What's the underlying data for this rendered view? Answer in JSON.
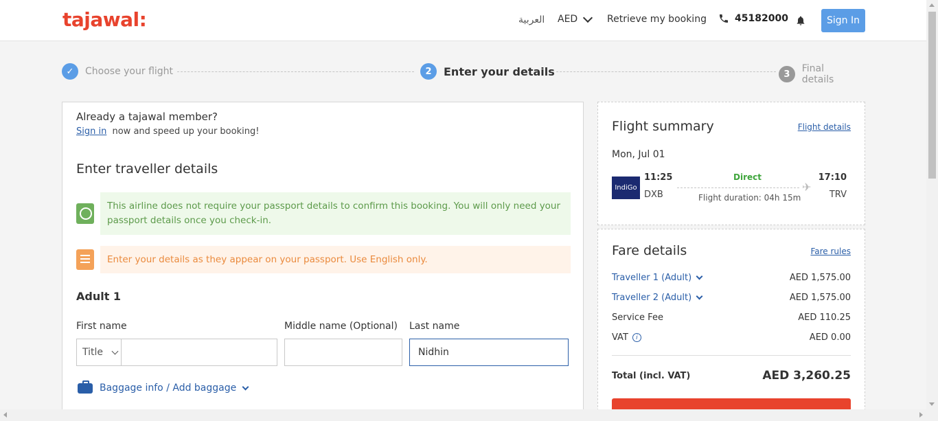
{
  "header": {
    "logo": "tajawal:",
    "language": "العربية",
    "currency": "AED",
    "retrieve": "Retrieve my booking",
    "phone": "45182000",
    "signin": "Sign In"
  },
  "stepper": {
    "step1": {
      "number": "✓",
      "label": "Choose your flight"
    },
    "step2": {
      "number": "2",
      "label": "Enter your details"
    },
    "step3": {
      "number": "3",
      "label": "Final details"
    }
  },
  "member": {
    "title": "Already a tajawal member?",
    "signin_link": "Sign in",
    "subtitle": "now and speed up your booking!"
  },
  "traveller": {
    "title": "Enter traveller details",
    "alert_passport": "This airline does not require your passport details to confirm this booking. You will only need your passport details once you check-in.",
    "alert_english": "Enter your details as they appear on your passport. Use English only.",
    "adult_title": "Adult 1",
    "first_name_label": "First name",
    "middle_name_label": "Middle name (Optional)",
    "last_name_label": "Last name",
    "title_select": "Title",
    "first_name_value": "",
    "middle_name_value": "",
    "last_name_value": "Nidhin",
    "baggage_link": "Baggage info / Add baggage"
  },
  "summary": {
    "title": "Flight summary",
    "details_link": "Flight details",
    "date": "Mon, Jul 01",
    "airline": "IndiGo",
    "dep_time": "11:25",
    "dep_code": "DXB",
    "stops": "Direct",
    "duration": "Flight duration: 04h 15m",
    "arr_time": "17:10",
    "arr_code": "TRV"
  },
  "fare": {
    "title": "Fare details",
    "rules_link": "Fare rules",
    "rows": [
      {
        "name": "Traveller 1 (Adult)",
        "value": "AED 1,575.00"
      },
      {
        "name": "Traveller 2 (Adult)",
        "value": "AED 1,575.00"
      },
      {
        "name": "Service Fee",
        "value": "AED 110.25"
      },
      {
        "name": "VAT",
        "value": "AED 0.00"
      }
    ],
    "total_label": "Total (incl. VAT)",
    "total_value": "AED 3,260.25"
  },
  "colors": {
    "brand": "#e8432d",
    "accent": "#5b9de6",
    "link": "#2a5ea8",
    "success": "#3fa53c",
    "warning": "#ea8a3d"
  }
}
